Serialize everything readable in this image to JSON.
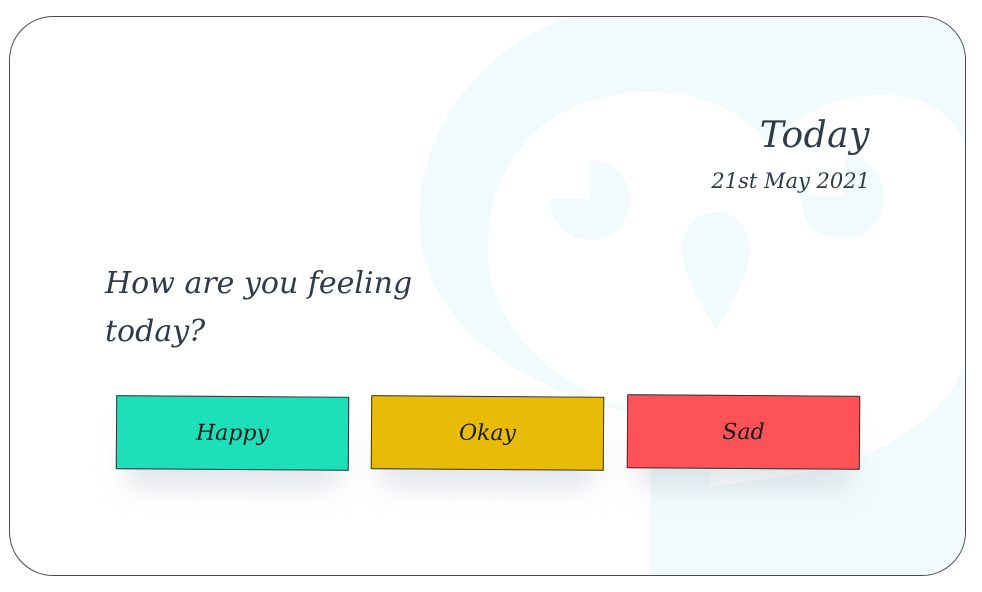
{
  "header": {
    "title": "Today",
    "date": "21st May 2021"
  },
  "prompt": {
    "question": "How are you feeling today?"
  },
  "moods": [
    {
      "label": "Happy",
      "color": "#1de0bb"
    },
    {
      "label": "Okay",
      "color": "#e8bc06"
    },
    {
      "label": "Sad",
      "color": "#fd5356"
    }
  ],
  "theme": {
    "text_color": "#2f3b48",
    "mascot_color": "#f1fbfc"
  },
  "background": {
    "icon": "owl-mascot-icon"
  }
}
